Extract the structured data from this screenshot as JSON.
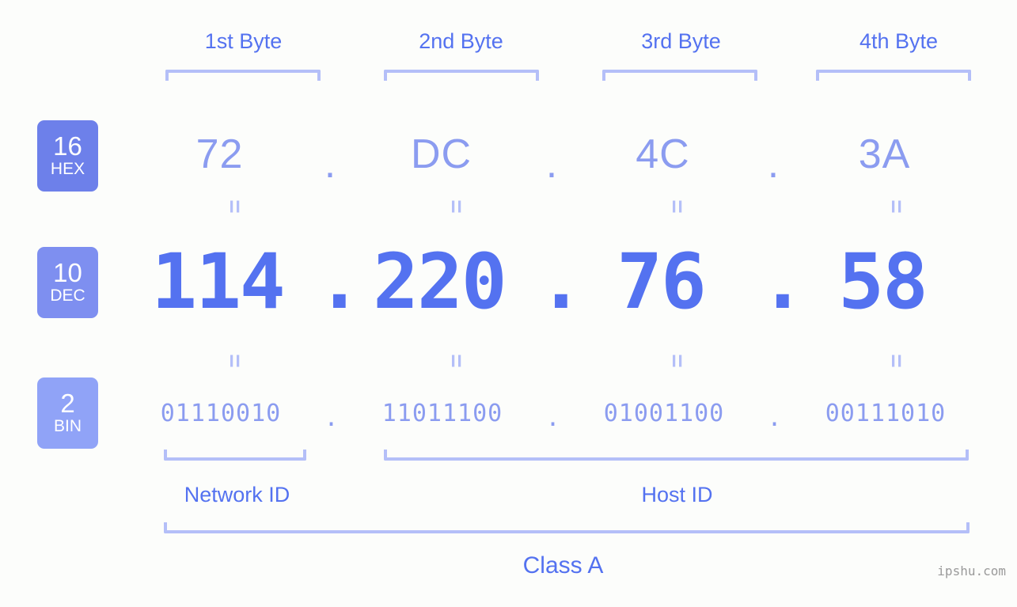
{
  "headers": [
    {
      "label": "1st Byte"
    },
    {
      "label": "2nd Byte"
    },
    {
      "label": "3rd Byte"
    },
    {
      "label": "4th Byte"
    }
  ],
  "badges": [
    {
      "base": "16",
      "name": "HEX",
      "color": "#6d80ea"
    },
    {
      "base": "10",
      "name": "DEC",
      "color": "#7e8ff0"
    },
    {
      "base": "2",
      "name": "BIN",
      "color": "#90a3f7"
    }
  ],
  "rows": {
    "hex": {
      "values": [
        "72",
        "DC",
        "4C",
        "3A"
      ],
      "separator": "."
    },
    "dec": {
      "values": [
        "114",
        "220",
        "76",
        "58"
      ],
      "separator": "."
    },
    "bin": {
      "values": [
        "01110010",
        "11011100",
        "01001100",
        "00111010"
      ],
      "separator": "."
    }
  },
  "equals_symbol": "=",
  "segments": {
    "network_id": "Network ID",
    "host_id": "Host ID"
  },
  "class_label": "Class A",
  "watermark": "ipshu.com",
  "colors": {
    "background": "#fcfdfb",
    "primary_blue": "#5472f0",
    "light_blue": "#8b9cf0",
    "bracket": "#b4bff8",
    "watermark_gray": "#9a9a9a"
  }
}
